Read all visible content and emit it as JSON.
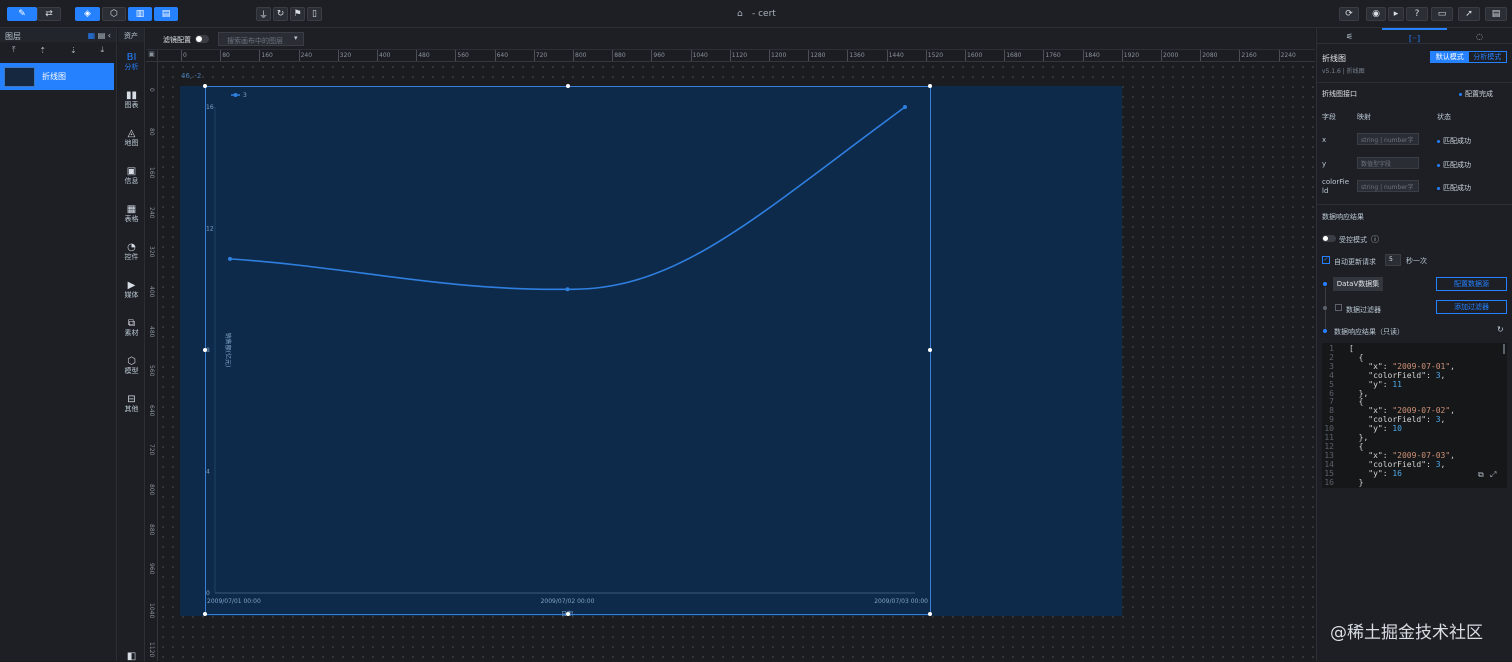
{
  "app": {
    "title": "- cert"
  },
  "layer_panel": {
    "title": "图层",
    "item": "折线图"
  },
  "nav": {
    "header": "资产",
    "items": [
      {
        "label": "分析",
        "icon": "bi-icon",
        "glyph": "BI"
      },
      {
        "label": "图表",
        "icon": "bar-chart-icon",
        "glyph": "▮▮"
      },
      {
        "label": "地图",
        "icon": "map-icon",
        "glyph": "◬"
      },
      {
        "label": "信息",
        "icon": "text-icon",
        "glyph": "▣"
      },
      {
        "label": "表格",
        "icon": "table-icon",
        "glyph": "▦"
      },
      {
        "label": "控件",
        "icon": "control-icon",
        "glyph": "◔"
      },
      {
        "label": "媒体",
        "icon": "media-icon",
        "glyph": "▶"
      },
      {
        "label": "素材",
        "icon": "material-icon",
        "glyph": "⧉"
      },
      {
        "label": "模型",
        "icon": "model-icon",
        "glyph": "⬡"
      },
      {
        "label": "其他",
        "icon": "other-icon",
        "glyph": "⊟"
      }
    ]
  },
  "filter": {
    "label": "滤镜配置",
    "placeholder": "搜索画布中的图层"
  },
  "ruler": {
    "h": [
      "0",
      "80",
      "160",
      "240",
      "320",
      "400",
      "480",
      "560",
      "640",
      "720",
      "800",
      "880",
      "960",
      "1040",
      "1120",
      "1200",
      "1280",
      "1360",
      "1440",
      "1520",
      "1600",
      "1680",
      "1760",
      "1840",
      "1920",
      "2000",
      "2080",
      "2160",
      "2240"
    ],
    "v": [
      "0",
      "80",
      "160",
      "240",
      "320",
      "400",
      "480",
      "560",
      "640",
      "720",
      "800",
      "880",
      "960",
      "1040",
      "1120"
    ]
  },
  "selection": {
    "coords": "46, -2"
  },
  "chart_data": {
    "type": "line",
    "x": [
      "2009/07/01 00:00",
      "2009/07/02 00:00",
      "2009/07/03 00:00"
    ],
    "series": [
      {
        "name": "3",
        "values": [
          11,
          10,
          16
        ]
      }
    ],
    "yticks": [
      "16",
      "12",
      "8",
      "4",
      "0"
    ],
    "ylim": [
      0,
      16
    ],
    "xlabel": "日期",
    "ylabel": "销售额(亿元)",
    "grid": false,
    "legend": "top-left",
    "color": "#2f7fe0"
  },
  "right_panel": {
    "tabs": [
      "settings-icon",
      "data-icon",
      "interaction-icon"
    ],
    "component_title": "折线图",
    "version": "v5.1.6 | 折线图",
    "modes": [
      "默认模式",
      "分析模式"
    ],
    "interface_title": "折线图接口",
    "config_status": "配置完成",
    "headers": {
      "field": "字段",
      "mapping": "映射",
      "status": "状态"
    },
    "fields": [
      {
        "name": "x",
        "mapping": "string | number字",
        "status": "匹配成功"
      },
      {
        "name": "y",
        "mapping": "数值型字段",
        "status": "匹配成功"
      },
      {
        "name": "colorFie\nld",
        "mapping": "string | number字",
        "status": "匹配成功"
      }
    ],
    "response_title": "数据响应结果",
    "controlled_mode": "受控模式",
    "auto_update": "自动更新请求",
    "interval": "5",
    "per_second": "秒一次",
    "source": "DataV数据集",
    "config_source_btn": "配置数据源",
    "filter_label": "数据过滤器",
    "add_filter_btn": "添加过滤器",
    "result_label": "数据响应结果（只读）",
    "code_lines": [
      "[",
      "  {",
      "    \"x\": \"2009-07-01\",",
      "    \"colorField\": 3,",
      "    \"y\": 11",
      "  },",
      "  {",
      "    \"x\": \"2009-07-02\",",
      "    \"colorField\": 3,",
      "    \"y\": 10",
      "  },",
      "  {",
      "    \"x\": \"2009-07-03\",",
      "    \"colorField\": 3,",
      "    \"y\": 16",
      "  }"
    ]
  },
  "watermark": "@稀土掘金技术社区"
}
